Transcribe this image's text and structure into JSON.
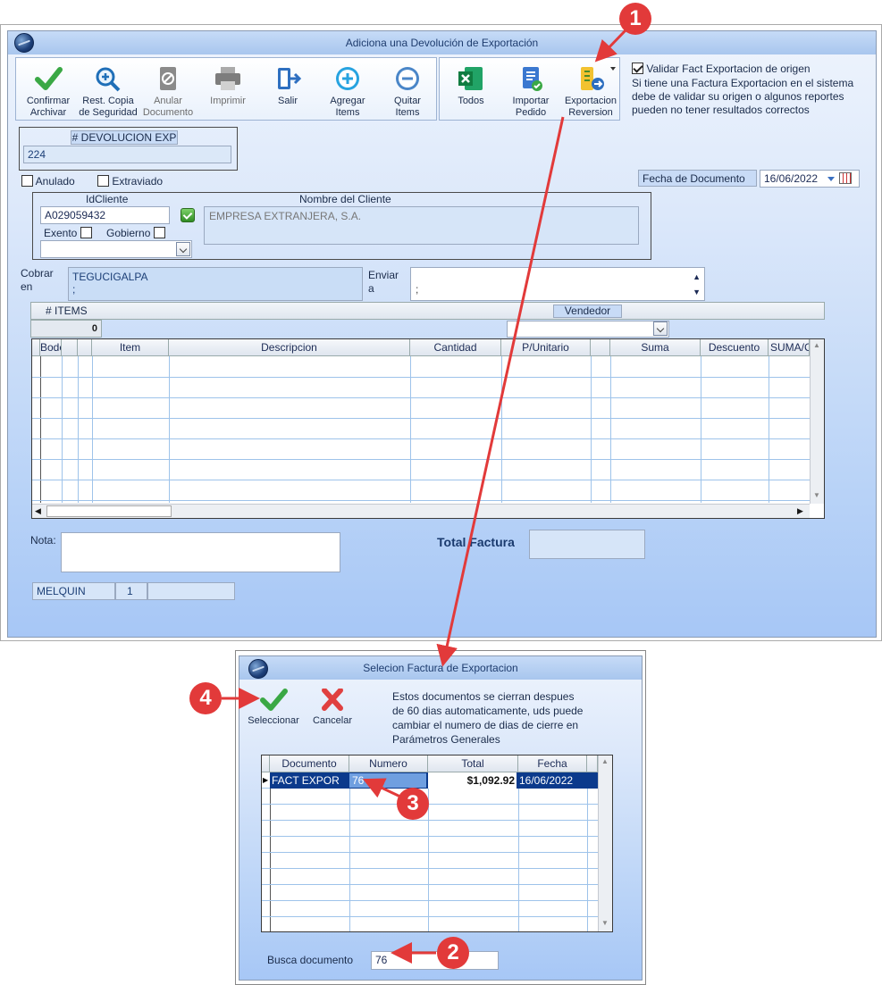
{
  "main_window": {
    "title": "Adiciona una Devolución de Exportación",
    "toolbar": {
      "confirmar": "Confirmar\nArchivar",
      "rest_copia": "Rest. Copia\nde Seguridad",
      "anular": "Anular\nDocumento",
      "imprimir": "Imprimir",
      "salir": "Salir",
      "agregar": "Agregar\nItems",
      "quitar": "Quitar\nItems",
      "todos": "Todos",
      "importar": "Importar\nPedido",
      "exportacion": "Exportacion\nReversion"
    },
    "validar_label": "Validar Fact Exportacion de origen",
    "validar_checked": true,
    "validar_note": "Si tiene una Factura Exportacion en el sistema\ndebe de validar su origen o algunos reportes\npueden no tener resultados correctos",
    "devolucion_label": "# DEVOLUCION EXP",
    "devolucion_value": "224",
    "anulado_label": "Anulado",
    "extraviado_label": "Extraviado",
    "fecha_label": "Fecha de  Documento",
    "fecha_value": "16/06/2022",
    "idcliente_label": "IdCliente",
    "idcliente_value": "A029059432",
    "nombre_label": "Nombre del Cliente",
    "nombre_value": "EMPRESA EXTRANJERA, S.A.",
    "exento_label": "Exento",
    "gobierno_label": "Gobierno",
    "cobrar_label": "Cobrar\nen",
    "cobrar_value": "TEGUCIGALPA\n;",
    "enviar_label": "Enviar\na",
    "enviar_value": "\n;",
    "items_label": "# ITEMS",
    "items_count": "0",
    "vendedor_label": "Vendedor",
    "grid_columns": [
      "Bodega",
      "",
      "Item",
      "Descripcion",
      "Cantidad",
      "P/Unitario",
      "",
      "Suma",
      "Descuento",
      "SUMA/C"
    ],
    "nota_label": "Nota:",
    "total_label": "Total Factura",
    "status": [
      "MELQUIN",
      "1",
      ""
    ]
  },
  "dialog": {
    "title": "Selecion Factura de Exportacion",
    "seleccionar": "Seleccionar",
    "cancelar": "Cancelar",
    "note": "Estos documentos se cierran despues\nde 60 dias automaticamente, uds puede\ncambiar el numero de dias de cierre en\nParámetros Generales",
    "columns": [
      "Documento",
      "Numero",
      "Total",
      "Fecha"
    ],
    "rows": [
      {
        "documento": "FACT EXPOR",
        "numero": "76",
        "total": "$1,092.92",
        "fecha": "16/06/2022"
      }
    ],
    "busca_label": "Busca documento",
    "busca_value": "76"
  },
  "markers": [
    "1",
    "2",
    "3",
    "4"
  ],
  "colors": {
    "marker": "#e23a3a",
    "selected_row": "#0b3a8c",
    "accent": "#a7c7f6"
  }
}
